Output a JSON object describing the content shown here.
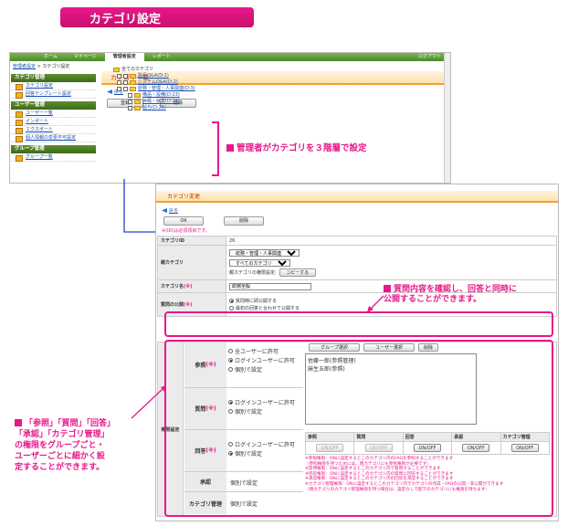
{
  "banner": {
    "title": "カテゴリ設定"
  },
  "win1": {
    "nav": [
      "ホーム",
      "マイページ",
      "管理者設定",
      "レポート"
    ],
    "logout": "ログアウト",
    "crumb": {
      "link": "管理者設定",
      "sep": " > ",
      "current": "カテゴリ設定"
    },
    "groups": [
      {
        "title": "カテゴリ管理",
        "items": [
          "カテゴリ設定",
          "回答テンプレート設定"
        ]
      },
      {
        "title": "ユーザー管理",
        "items": [
          "ユーザー一覧",
          "インポート",
          "エクスポート",
          "個人情報の変更不可設定"
        ]
      },
      {
        "title": "グループ管理",
        "items": [
          "グループ一覧"
        ]
      }
    ],
    "page_title": "カテゴリ一覧",
    "back": "戻る",
    "register": "登録",
    "delete": "削除",
    "tree": [
      "全てのカテゴリ",
      "製品Q&A(D:1)",
      "システムQ&A(D:2)",
      "総務・管理・人事関連(D:3)",
      "備品・設備(D:23)",
      "休暇・就業(D:24)",
      "給与(D:25)"
    ]
  },
  "ann1": "管理者がカテゴリを３階層で設定",
  "ann2": [
    "質問内容を確認し、回答と同時に",
    "公開することができます。"
  ],
  "ann3": [
    "「参照」「質問」「回答」",
    "「承認」「カテゴリ管理」",
    "の権限をグループごと・",
    "ユーザーごとに細かく設",
    "定することができます。"
  ],
  "win2": {
    "title": "カテゴリ変更",
    "back": "戻る",
    "ok": "OK",
    "delete": "削除",
    "note": "※(ID)は必須項目です。",
    "id_label": "カテゴリID",
    "id_value": "26",
    "parent_label": "親カテゴリ",
    "parent_sel1": "総務・管理・人事関連",
    "parent_sel2": "すべてのカテゴリ",
    "parent_perm": "親カテゴリの権限設定:",
    "copy_btn": "コピーする",
    "name_label": "カテゴリ名",
    "name_value": "総務全般",
    "req": "(※)",
    "pub_label": "質問の公開",
    "pub_opts": [
      "質問時に即公開する",
      "最初の回答と合わせて公開する"
    ],
    "perm_label": "権限設定",
    "perm_rows": [
      {
        "label": "参照",
        "opts": [
          "全ユーザーに許可",
          "ログインユーザーに許可",
          "個別で設定"
        ]
      },
      {
        "label": "質問",
        "opts": [
          "ログインユーザーに許可",
          "個別で設定"
        ]
      },
      {
        "label": "回答",
        "opts": [
          "ログインユーザーに許可",
          "個別で設定"
        ]
      },
      {
        "label": "承認",
        "opts": [
          "個別で設定"
        ]
      },
      {
        "label": "カテゴリ管理",
        "opts": [
          "個別で設定"
        ]
      }
    ],
    "group_btn": "グループ選択",
    "user_btn": "ユーザー選択",
    "del_btn": "削除",
    "members": [
      "佐藤一郎(参照管理)",
      "麻生五郎(参照)"
    ],
    "cols": [
      "参照",
      "質問",
      "回答",
      "承認",
      "カテゴリ管理"
    ],
    "onoff": "ON/OFF",
    "notes": [
      "※参照権限：ONに設定するとこのカテゴリ内のFAQを参照することができます",
      "（参照権限を持つためには、親カテゴリにも参照権限が必要です）",
      "※質問権限：ONに設定するとこのカテゴリ内で質問することができます",
      "※回答権限：ONに設定するとこのカテゴリ内の質問に回答することができます",
      "※承認権限：ONに設定するとこのカテゴリ内の回答を承認することができます",
      "※カテゴリ管理権限：ONに設定するとこのカテゴリ内でカテゴリの作成・FAQの公開／非公開ができます",
      "（親カテゴリのカテゴリ管理権限を持つ場合は、設定なしで配下のカテゴリにも権限を持ちます）"
    ]
  },
  "colors": {
    "accent": "#e8188a",
    "nav": "#4b8a2a",
    "title": "#cc3300"
  }
}
